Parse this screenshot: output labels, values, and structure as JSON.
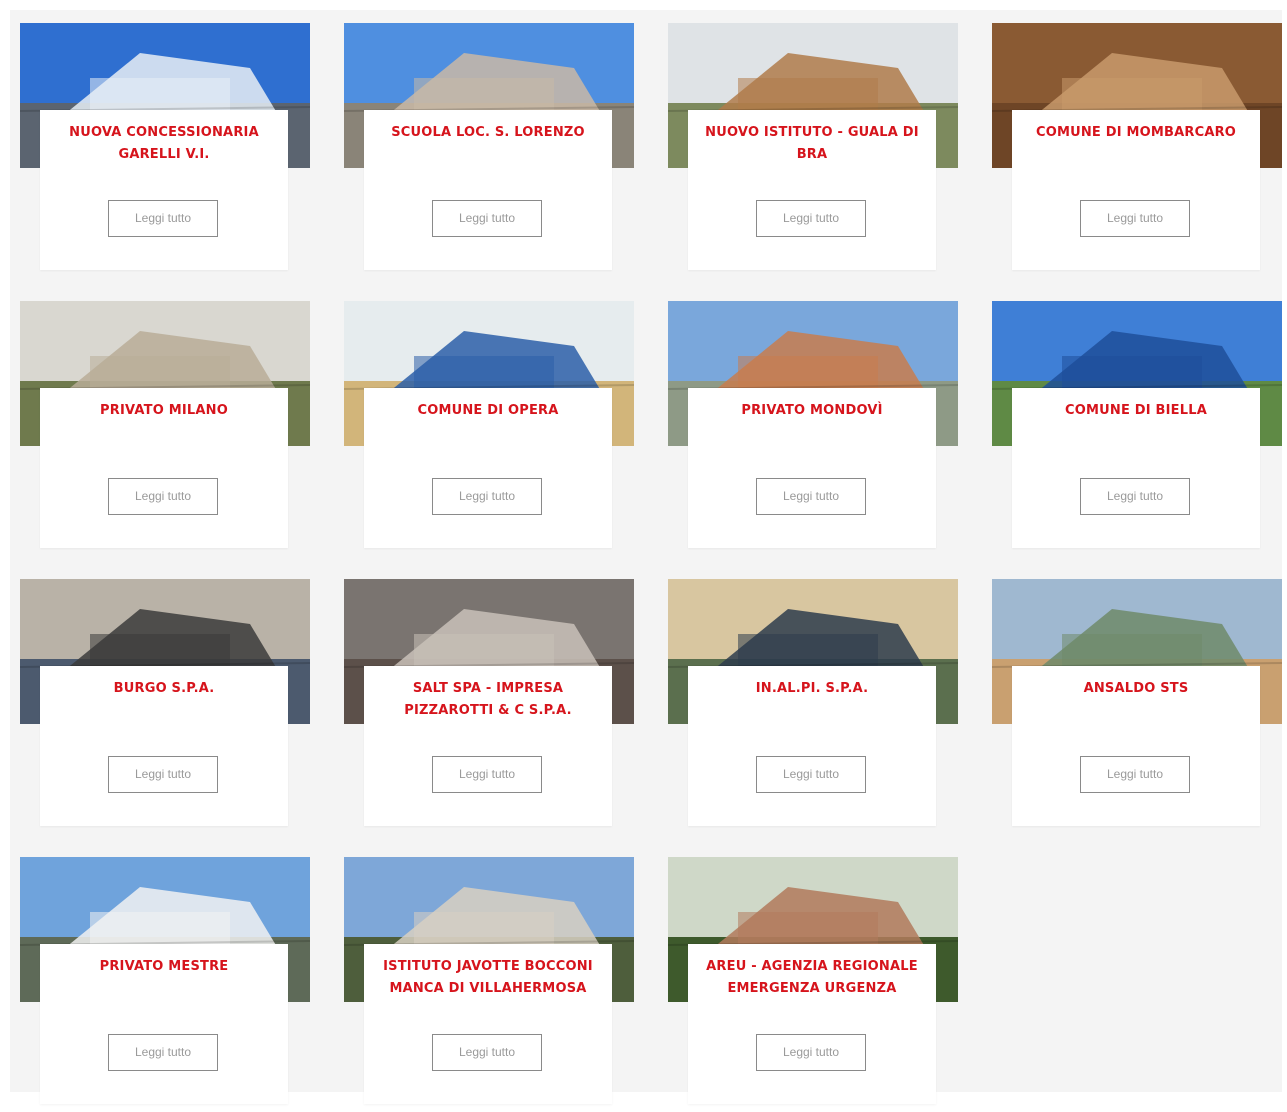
{
  "projects": [
    {
      "title": "Nuova concessionaria Garelli V.I.",
      "button": "Leggi tutto",
      "sky": "#2f6fd0",
      "ground": "#5b6470",
      "accent": "#e8eef5"
    },
    {
      "title": "Scuola loc. S. Lorenzo",
      "button": "Leggi tutto",
      "sky": "#4f8fe0",
      "ground": "#8a8478",
      "accent": "#c9b9a6"
    },
    {
      "title": "Nuovo istituto - Guala di Bra",
      "button": "Leggi tutto",
      "sky": "#dfe3e6",
      "ground": "#7d8a5e",
      "accent": "#b07b4a"
    },
    {
      "title": "Comune di Mombarcaro",
      "button": "Leggi tutto",
      "sky": "#8a5a33",
      "ground": "#6e4526",
      "accent": "#c89a6c"
    },
    {
      "title": "Privato Milano",
      "button": "Leggi tutto",
      "sky": "#d9d7d0",
      "ground": "#6f7a4d",
      "accent": "#b8ad98"
    },
    {
      "title": "Comune di Opera",
      "button": "Leggi tutto",
      "sky": "#e6ecee",
      "ground": "#d2b57a",
      "accent": "#2b5fa8"
    },
    {
      "title": "Privato Mondovì",
      "button": "Leggi tutto",
      "sky": "#7aa7db",
      "ground": "#8e9a86",
      "accent": "#c87c4e"
    },
    {
      "title": "Comune di Biella",
      "button": "Leggi tutto",
      "sky": "#3f7fd6",
      "ground": "#5f8a45",
      "accent": "#1f4f9a"
    },
    {
      "title": "Burgo S.p.a.",
      "button": "Leggi tutto",
      "sky": "#b9b2a7",
      "ground": "#4c5a6e",
      "accent": "#3b3b3b"
    },
    {
      "title": "Salt spa - Impresa Pizzarotti & C S.p.a.",
      "button": "Leggi tutto",
      "sky": "#7a7470",
      "ground": "#5c504a",
      "accent": "#c9c1b8"
    },
    {
      "title": "In.Al.Pi. S.p.a.",
      "button": "Leggi tutto",
      "sky": "#d8c6a0",
      "ground": "#5b6f4e",
      "accent": "#2e3c4c"
    },
    {
      "title": "Ansaldo STS",
      "button": "Leggi tutto",
      "sky": "#9fb8d0",
      "ground": "#c9a070",
      "accent": "#6f8a6a"
    },
    {
      "title": "Privato Mestre",
      "button": "Leggi tutto",
      "sky": "#6fa3dc",
      "ground": "#5e6a58",
      "accent": "#f2f2f2"
    },
    {
      "title": "Istituto Javotte Bocconi Manca di Villahermosa",
      "button": "Leggi tutto",
      "sky": "#7ea7d8",
      "ground": "#4e5e3c",
      "accent": "#d8d0c2"
    },
    {
      "title": "Areu - Agenzia Regionale Emergenza Urgenza",
      "button": "Leggi tutto",
      "sky": "#cfd8c8",
      "ground": "#3e5a2c",
      "accent": "#b27a5c"
    }
  ]
}
